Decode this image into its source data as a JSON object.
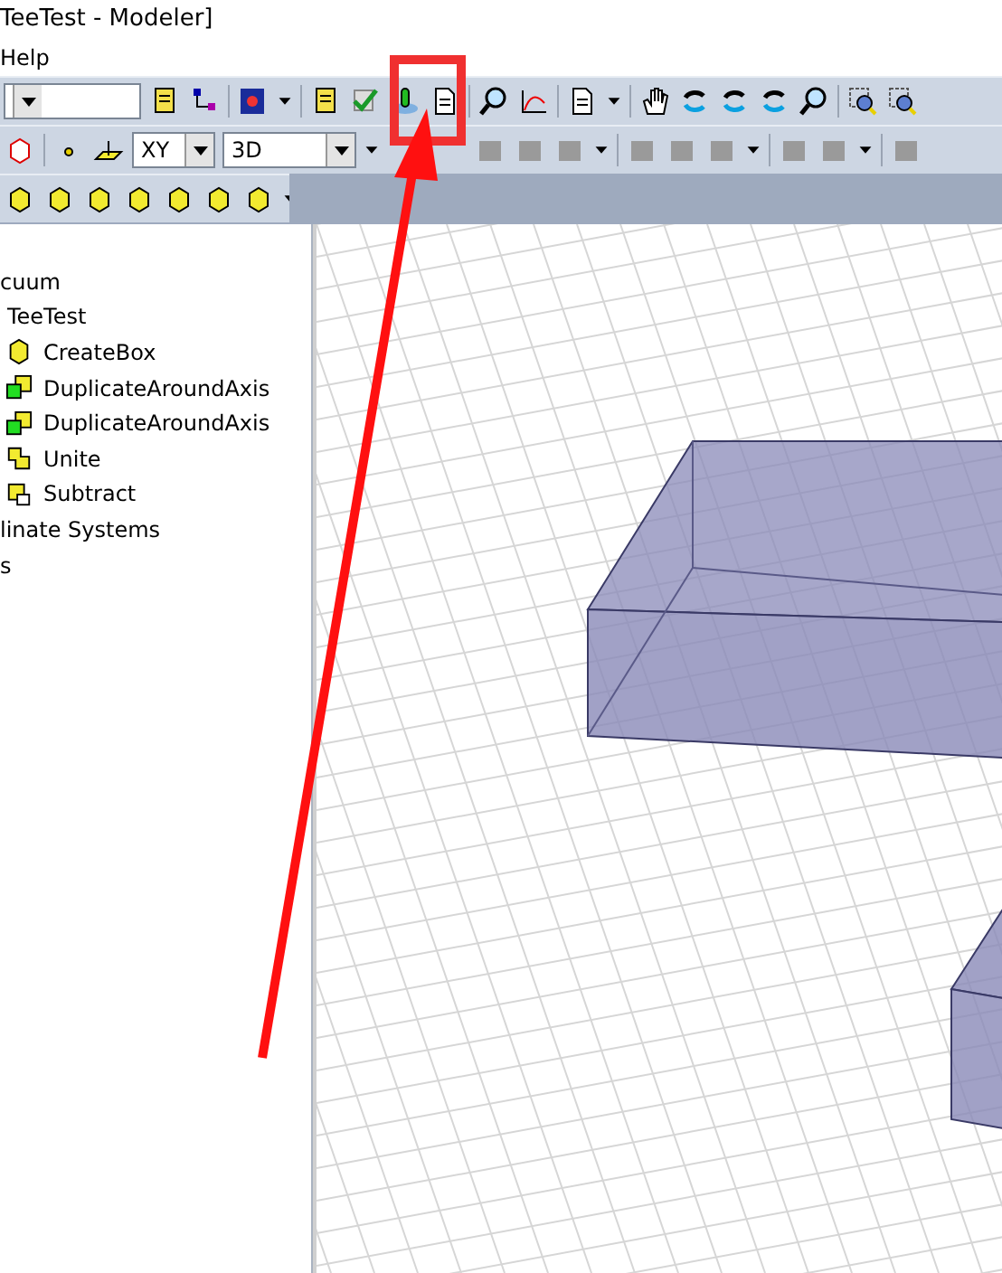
{
  "window": {
    "title": "TeeTest - Modeler]"
  },
  "menu": [
    {
      "label": "Help"
    }
  ],
  "toolbar": {
    "plane": "XY",
    "view": "3D"
  },
  "tree": [
    {
      "label": "cuum"
    },
    {
      "label": "TeeTest",
      "children": [
        {
          "label": "CreateBox",
          "kind": "box"
        },
        {
          "label": "DuplicateAroundAxis",
          "kind": "duplicate"
        },
        {
          "label": "DuplicateAroundAxis",
          "kind": "duplicate"
        },
        {
          "label": "Unite",
          "kind": "unite"
        },
        {
          "label": "Subtract",
          "kind": "subtract"
        }
      ]
    },
    {
      "label": "linate Systems"
    },
    {
      "label": "s"
    }
  ]
}
